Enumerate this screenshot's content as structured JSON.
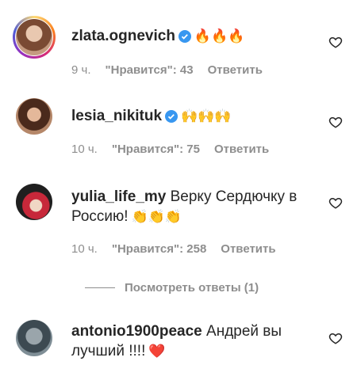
{
  "comments": [
    {
      "username": "zlata.ognevich",
      "verified": true,
      "text": "",
      "emoji": "🔥🔥🔥",
      "time": "9 ч.",
      "likes": "\"Нравится\": 43",
      "reply": "Ответить"
    },
    {
      "username": "lesia_nikituk",
      "verified": true,
      "text": "",
      "emoji": "🙌🙌🙌",
      "time": "10 ч.",
      "likes": "\"Нравится\": 75",
      "reply": "Ответить"
    },
    {
      "username": "yulia_life_my",
      "verified": false,
      "text": "Верку Сердючку в Россию!",
      "emoji": "👏👏👏",
      "time": "10 ч.",
      "likes": "\"Нравится\": 258",
      "reply": "Ответить"
    },
    {
      "username": "antonio1900peace",
      "verified": false,
      "text": "Андрей вы лучший !!!!",
      "emoji": "❤️",
      "time": "",
      "likes": "",
      "reply": ""
    }
  ],
  "view_replies": "Посмотреть ответы (1)",
  "colors": {
    "verified": "#3897f0",
    "meta": "#8e8e8e",
    "heart_stroke": "#262626"
  },
  "icons": {
    "like": "heart-outline-icon",
    "verified": "verified-badge-icon"
  }
}
